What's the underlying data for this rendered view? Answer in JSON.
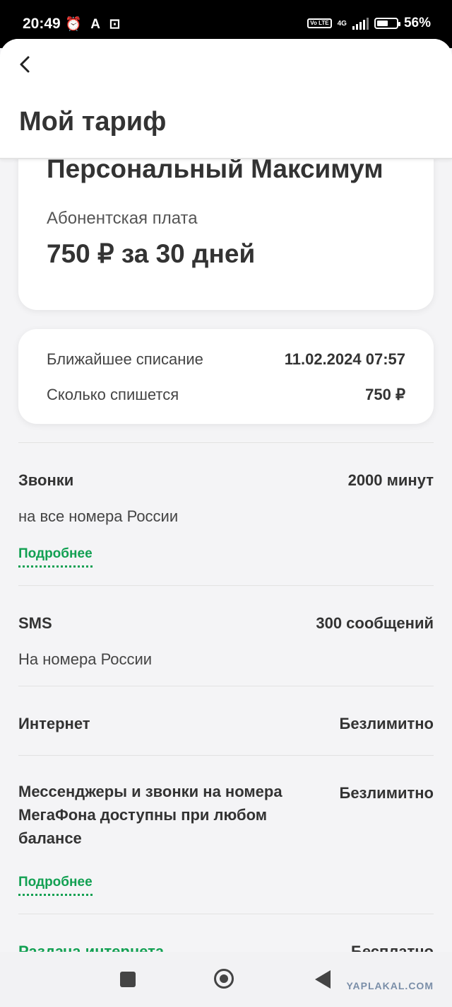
{
  "status_bar": {
    "time": "20:49",
    "left_icons": "⏰ A ⊡",
    "network": "4G",
    "volte": "Vo LTE",
    "battery": "56%",
    "battery_level": 0.56
  },
  "header": {
    "title": "Мой тариф"
  },
  "tariff": {
    "name": "Персональный Максимум",
    "fee_label": "Абонентская плата",
    "fee_value": "750 ₽ за 30 дней"
  },
  "billing": {
    "next_charge_label": "Ближайшее списание",
    "next_charge_value": "11.02.2024 07:57",
    "amount_label": "Сколько спишется",
    "amount_value": "750 ₽"
  },
  "sections": {
    "calls": {
      "title": "Звонки",
      "value": "2000 минут",
      "subtitle": "на все номера России",
      "more": "Подробнее"
    },
    "sms": {
      "title": "SMS",
      "value": "300 сообщений",
      "subtitle": "На номера России"
    },
    "internet": {
      "title": "Интернет",
      "value": "Безлимитно"
    },
    "messengers": {
      "title": "Мессенджеры и звонки на номера МегаФона доступны при любом балансе",
      "value": "Безлимитно",
      "more": "Подробнее"
    },
    "sharing": {
      "title": "Раздача интернета",
      "value": "Бесплатно"
    }
  },
  "watermark": "YAPLAKAL.COM"
}
